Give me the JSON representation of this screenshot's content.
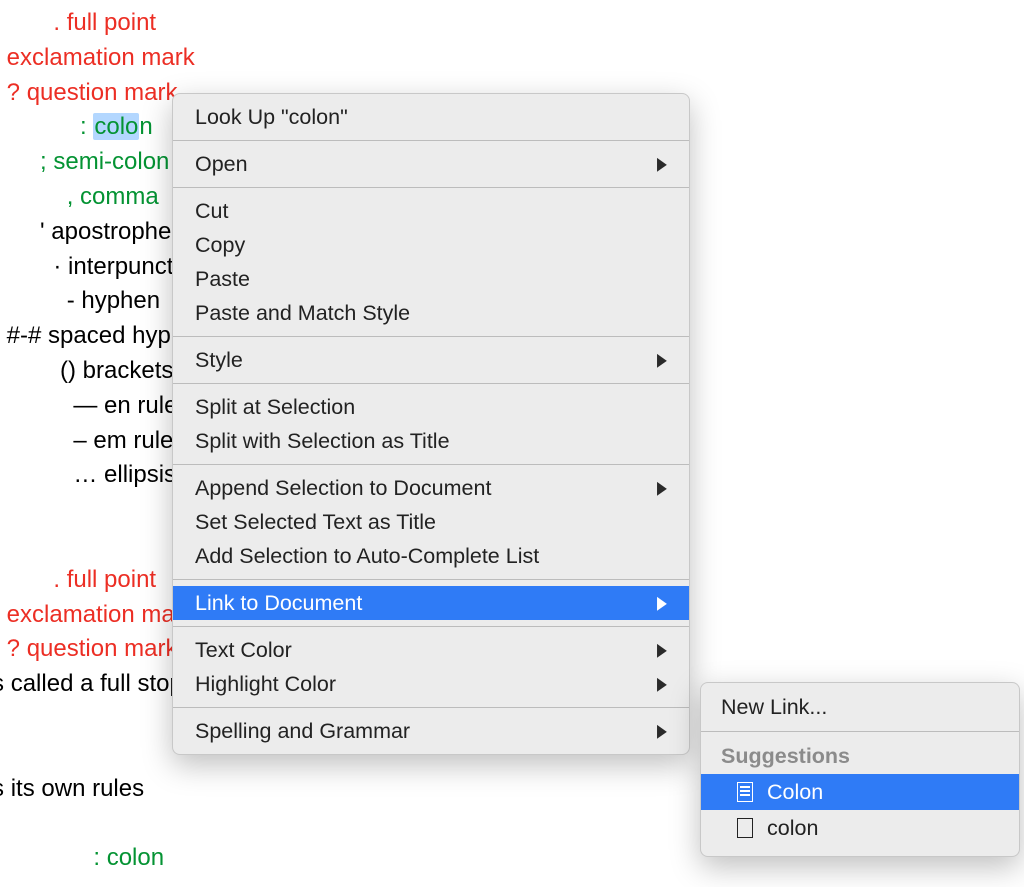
{
  "document": {
    "lines": [
      {
        "color": "red",
        "indent": "                    ",
        "text": ". full point"
      },
      {
        "color": "red",
        "indent": "           ",
        "text": "! exclamation mark"
      },
      {
        "color": "red",
        "indent": "             ",
        "text": "? question mark"
      },
      {
        "color": "green",
        "indent": "                        ",
        "prefix": ": ",
        "selected": "colo",
        "suffix": "n"
      },
      {
        "color": "green",
        "indent": "                  ",
        "text": "; semi-colon"
      },
      {
        "color": "green",
        "indent": "                      ",
        "text": ", comma"
      },
      {
        "color": "black",
        "indent": "                  ",
        "text": "' apostrophe"
      },
      {
        "color": "black",
        "indent": "                    ",
        "text": "· interpunct"
      },
      {
        "color": "black",
        "indent": "                      ",
        "text": "- hyphen"
      },
      {
        "color": "black",
        "indent": "             ",
        "text": "#-# spaced hyphen"
      },
      {
        "color": "black",
        "indent": "                     ",
        "text": "() brackets"
      },
      {
        "color": "black",
        "indent": "                       ",
        "text": "— en rule"
      },
      {
        "color": "black",
        "indent": "                       ",
        "text": "– em rule"
      },
      {
        "color": "black",
        "indent": "                       ",
        "text": "… ellipsis"
      },
      {
        "color": "black",
        "indent": "",
        "text": " "
      },
      {
        "color": "black",
        "indent": "",
        "text": " "
      },
      {
        "color": "red",
        "indent": "                    ",
        "text": ". full point"
      },
      {
        "color": "red",
        "indent": "           ",
        "text": "! exclamation mark"
      },
      {
        "color": "red",
        "indent": "             ",
        "text": "? question mark"
      },
      {
        "color": "black",
        "indent": "",
        "text": "netimes called a full stop"
      },
      {
        "color": "black",
        "indent": "",
        "text": " "
      },
      {
        "color": "black",
        "indent": "",
        "text": " "
      },
      {
        "color": "black",
        "indent": "",
        "text": "ach has its own rules"
      },
      {
        "color": "black",
        "indent": "",
        "text": " "
      },
      {
        "color": "green",
        "indent": "                          ",
        "text": ": colon"
      }
    ]
  },
  "contextMenu": {
    "lookup": "Look Up \"colon\"",
    "open": "Open",
    "cut": "Cut",
    "copy": "Copy",
    "paste": "Paste",
    "pasteMatch": "Paste and Match Style",
    "style": "Style",
    "splitAtSel": "Split at Selection",
    "splitWithTitle": "Split with Selection as Title",
    "appendSel": "Append Selection to Document",
    "setTitle": "Set Selected Text as Title",
    "addAuto": "Add Selection to Auto-Complete List",
    "linkDoc": "Link to Document",
    "textColor": "Text Color",
    "highlightColor": "Highlight Color",
    "spelling": "Spelling and Grammar"
  },
  "submenu": {
    "newLink": "New Link...",
    "suggestionsHeader": "Suggestions",
    "suggestions": [
      {
        "label": "Colon",
        "highlighted": true,
        "hasLines": true
      },
      {
        "label": "colon",
        "highlighted": false,
        "hasLines": false
      }
    ]
  }
}
